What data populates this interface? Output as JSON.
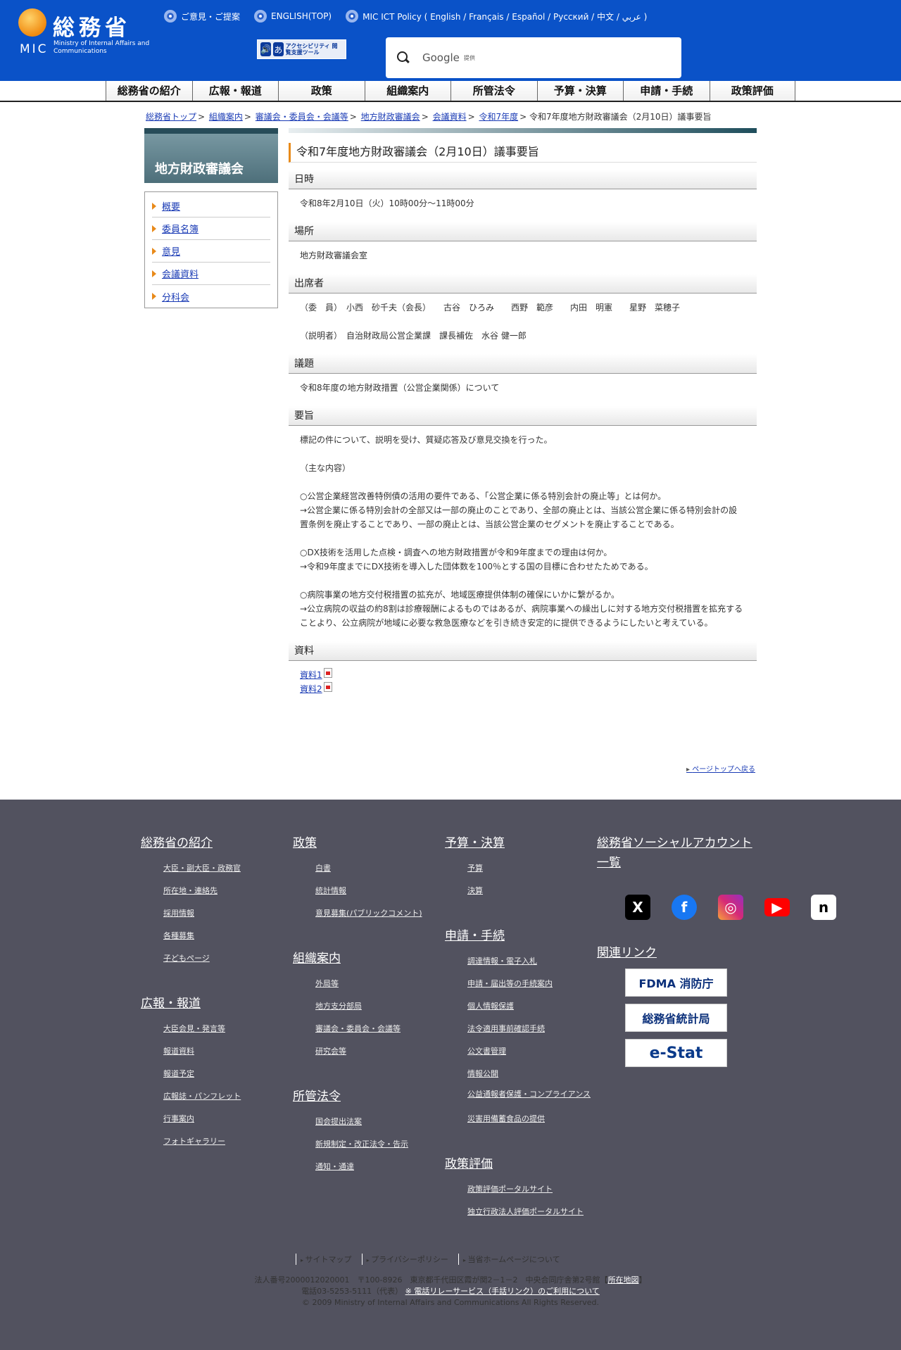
{
  "header": {
    "logo_jp": "総務省",
    "logo_mic": "MIC",
    "logo_en": "Ministry of Internal Affairs and Communications",
    "toplinks": [
      "ご意見・ご提案",
      "ENGLISH(TOP)",
      "MIC ICT Policy ( English / Français / Español / Русский / 中文 / عربي )"
    ],
    "a11y_icon1": "🔊",
    "a11y_icon2": "あ",
    "a11y_text": "アクセシビリティ 閲覧支援ツール",
    "search_brand": "Google",
    "search_suffix": "提供"
  },
  "gnav": [
    "総務省の紹介",
    "広報・報道",
    "政策",
    "組織案内",
    "所管法令",
    "予算・決算",
    "申請・手続",
    "政策評価"
  ],
  "breadcrumb": {
    "links": [
      "総務省トップ",
      "組織案内",
      "審議会・委員会・会議等",
      "地方財政審議会",
      "会議資料",
      "令和7年度"
    ],
    "current": "令和7年度地方財政審議会（2月10日）議事要旨"
  },
  "sidebar": {
    "title": "地方財政審議会",
    "items": [
      "概要",
      "委員名簿",
      "意見",
      "会議資料",
      "分科会"
    ]
  },
  "main": {
    "title": "令和7年度地方財政審議会（2月10日）議事要旨",
    "sections": {
      "datetime": {
        "heading": "日時",
        "body": "令和8年2月10日（火）10時00分～11時00分"
      },
      "place": {
        "heading": "場所",
        "body": "地方財政審議会室"
      },
      "attendees": {
        "heading": "出席者",
        "members": "（委　員）　小西　砂千夫（会長）　　古谷　ひろみ　　西野　範彦　　内田　明憲　　星野　菜穂子",
        "explainers": "（説明者）　自治財政局公営企業課　課長補佐　水谷 健一郎"
      },
      "agenda": {
        "heading": "議題",
        "body": "令和8年度の地方財政措置（公営企業関係）について"
      },
      "summary": {
        "heading": "要旨",
        "lines": [
          "標記の件について、説明を受け、質疑応答及び意見交換を行った。",
          "",
          "（主な内容）",
          "",
          "○公営企業経営改善特例債の活用の要件である、「公営企業に係る特別会計の廃止等」とは何か。",
          "→公営企業に係る特別会計の全部又は一部の廃止のことであり、全部の廃止とは、当該公営企業に係る特別会計の設置条例を廃止することであり、一部の廃止とは、当該公営企業のセグメントを廃止することである。",
          "",
          "○DX技術を活用した点検・調査への地方財政措置が令和9年度までの理由は何か。",
          "→令和9年度までにDX技術を導入した団体数を100％とする国の目標に合わせたためである。",
          "",
          "○病院事業の地方交付税措置の拡充が、地域医療提供体制の確保にいかに繋がるか。",
          "→公立病院の収益の約8割は診療報酬によるものではあるが、病院事業への繰出しに対する地方交付税措置を拡充することより、公立病院が地域に必要な救急医療などを引き続き安定的に提供できるようにしたいと考えている。"
        ]
      },
      "materials": {
        "heading": "資料",
        "links": [
          "資料1",
          "資料2"
        ]
      }
    },
    "pagetop": "ページトップへ戻る"
  },
  "footer": {
    "col1": [
      {
        "heading": "総務省の紹介",
        "items": [
          "大臣・副大臣・政務官",
          "所在地・連絡先",
          "採用情報",
          "各種募集",
          "子どもページ"
        ]
      },
      {
        "heading": "広報・報道",
        "items": [
          "大臣会見・発言等",
          "報道資料",
          "報道予定",
          "広報誌・パンフレット",
          "行事案内",
          "フォトギャラリー"
        ]
      }
    ],
    "col2": [
      {
        "heading": "政策",
        "items": [
          "白書",
          "統計情報",
          "意見募集(パブリックコメント)"
        ]
      },
      {
        "heading": "組織案内",
        "items": [
          "外局等",
          "地方支分部局",
          "審議会・委員会・会議等",
          "研究会等"
        ]
      },
      {
        "heading": "所管法令",
        "items": [
          "国会提出法案",
          "新規制定・改正法令・告示",
          "通知・通達"
        ]
      }
    ],
    "col3": [
      {
        "heading": "予算・決算",
        "items": [
          "予算",
          "決算"
        ]
      },
      {
        "heading": "申請・手続",
        "items": [
          "調達情報・電子入札",
          "申請・届出等の手続案内",
          "個人情報保護",
          "法令適用事前確認手続",
          "公文書管理",
          "情報公開",
          "公益通報者保護・コンプライアンス",
          "災害用備蓄食品の提供"
        ]
      },
      {
        "heading": "政策評価",
        "items": [
          "政策評価ポータルサイト",
          "独立行政法人評価ポータルサイト"
        ]
      }
    ],
    "social_heading": "総務省ソーシャルアカウント一覧",
    "social": [
      "X",
      "f",
      "◎",
      "▶",
      "n"
    ],
    "related_heading": "関連リンク",
    "banners": [
      "FDMA 消防庁",
      "総務省統計局",
      "e-Stat"
    ],
    "links": [
      "サイトマップ",
      "プライバシーポリシー",
      "当省ホームページについて"
    ],
    "address_line1": "法人番号2000012020001　〒100-8926　東京都千代田区霞が関2－1－2　中央合同庁舎第2号館【",
    "address_map": "所在地図",
    "address_line1_end": "】",
    "address_line2": "電話03-5253-5111（代表）",
    "relay": "※ 電話リレーサービス（手話リンク）のご利用について",
    "copyright": "© 2009 Ministry of Internal Affairs and Communications All Rights Reserved."
  },
  "colors": {
    "header_bg": "#0a52c8",
    "footer_bg": "#52525f",
    "accent": "#e88a1a"
  }
}
